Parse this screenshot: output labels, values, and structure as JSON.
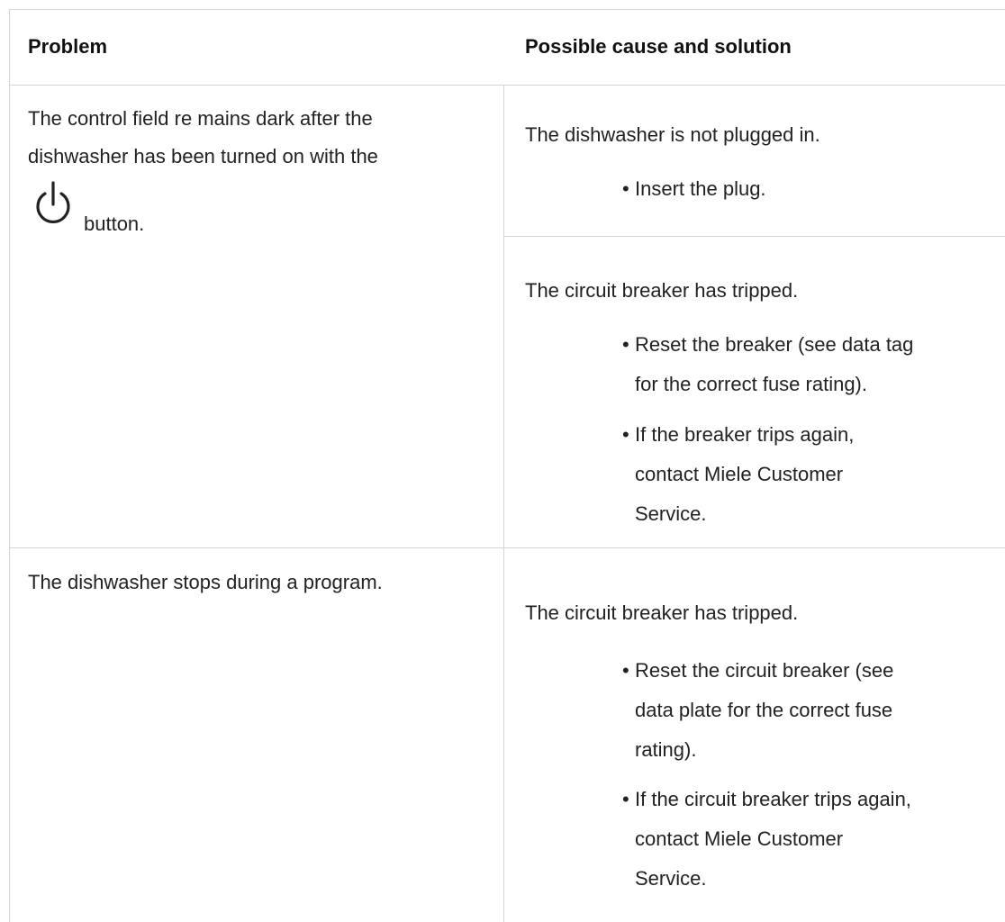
{
  "table": {
    "headers": {
      "problem": "Problem",
      "cause": "Possible cause and solution"
    },
    "rows": [
      {
        "problem_line1": "The control field re mains dark after the",
        "problem_line2": "dishwasher has been turned on with the",
        "problem_icon": "power-icon",
        "problem_line3": "button.",
        "causes": [
          {
            "cause": "The dishwasher is not plugged in.",
            "solutions": [
              "Insert the plug."
            ]
          },
          {
            "cause": "The circuit breaker has tripped.",
            "solutions": [
              [
                "Reset the breaker (see data tag",
                "for the correct fuse rating)."
              ],
              [
                "If the breaker trips again,",
                "contact Miele Customer",
                "Service."
              ]
            ]
          }
        ]
      },
      {
        "problem": "The dishwasher stops during a program.",
        "causes": [
          {
            "cause": "The circuit breaker has tripped.",
            "solutions": [
              [
                "Reset the circuit breaker (see",
                "data plate for the correct fuse",
                "rating)."
              ],
              [
                "If the circuit breaker trips again,",
                "contact Miele Customer",
                "Service."
              ]
            ]
          }
        ]
      }
    ]
  },
  "bullet_char": "•",
  "colors": {
    "border": "#d4d4d4",
    "text": "#222222"
  }
}
